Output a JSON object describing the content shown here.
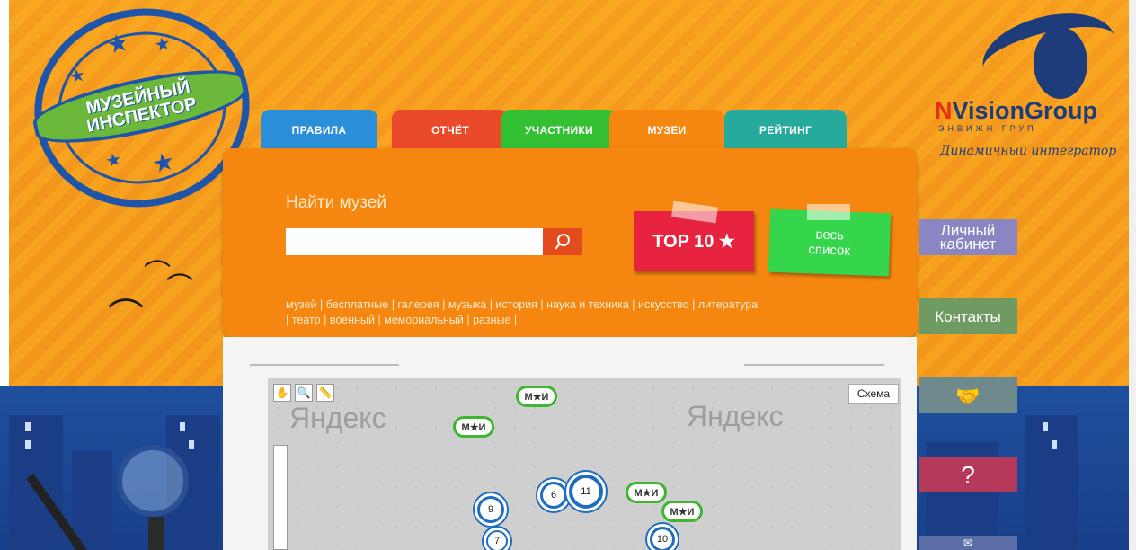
{
  "logo": {
    "line1": "МУЗЕЙНЫЙ",
    "line2": "ИНСПЕКТОР"
  },
  "tabs": [
    {
      "label": "ПРАВИЛА",
      "color": "#2a8fd8"
    },
    {
      "label": "ОТЧЁТ",
      "color": "#ea4a2a"
    },
    {
      "label": "УЧАСТНИКИ",
      "color": "#34c033"
    },
    {
      "label": "МУЗЕИ",
      "color": "#f5860f"
    },
    {
      "label": "РЕЙТИНГ",
      "color": "#25aa9c"
    }
  ],
  "search": {
    "label": "Найти музей",
    "value": "",
    "placeholder": ""
  },
  "buttons": {
    "top10": "TOP 10 ★",
    "all_list_line1": "весь",
    "all_list_line2": "список"
  },
  "categories": [
    "музей",
    "бесплатные",
    "галерея",
    "музыка",
    "история",
    "наука и техника",
    "искусство",
    "литература",
    "театр",
    "военный",
    "мемориальный",
    "разные"
  ],
  "map": {
    "watermark": "Яндекс",
    "scheme_button": "Схема",
    "pin_label": "М★И",
    "clusters": [
      "6",
      "11",
      "9",
      "7",
      "10"
    ]
  },
  "partner": {
    "name_prefix": "N",
    "name": "VisionGroup",
    "sub": "ЭНВИЖН ГРУП",
    "tagline": "Динамичный интегратор"
  },
  "side_buttons": {
    "cabinet_line1": "Личный",
    "cabinet_line2": "кабинет",
    "contacts": "Контакты",
    "question": "?"
  },
  "colors": {
    "accent": "#f5860f",
    "top10": "#e8233f",
    "all_list": "#35d64b",
    "map_pin": "#3fb631",
    "cluster": "#1f6dc1",
    "side_btn": "#8a86c4"
  }
}
